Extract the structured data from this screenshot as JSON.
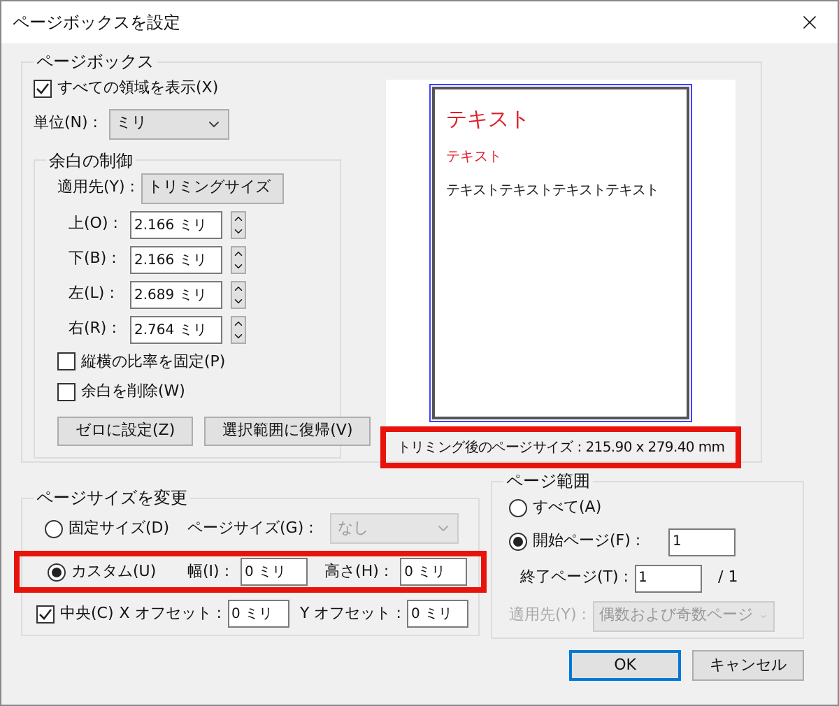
{
  "window": {
    "title": "ページボックスを設定"
  },
  "page_box": {
    "title": "ページボックス",
    "show_all": {
      "label": "すべての領域を表示(X)",
      "checked": true
    },
    "unit": {
      "label": "単位(N) :",
      "value": "ミリ"
    },
    "margins": {
      "title": "余白の制御",
      "apply_to": {
        "label": "適用先(Y) :",
        "value": "トリミングサイズ"
      },
      "fields": [
        {
          "label": "上(O) :",
          "value": "2.166 ミリ"
        },
        {
          "label": "下(B) :",
          "value": "2.166 ミリ"
        },
        {
          "label": "左(L) :",
          "value": "2.689 ミリ"
        },
        {
          "label": "右(R) :",
          "value": "2.764 ミリ"
        }
      ],
      "options": [
        {
          "label": "縦横の比率を固定(P)",
          "checked": false
        },
        {
          "label": "余白を削除(W)",
          "checked": false
        }
      ],
      "buttons": [
        "ゼロに設定(Z)",
        "選択範囲に復帰(V)"
      ]
    },
    "preview": {
      "lines": [
        {
          "text": "テキスト",
          "kind": "heading"
        },
        {
          "text": "テキスト",
          "kind": "subheading"
        },
        {
          "text": "テキストテキストテキストテキスト",
          "kind": "body"
        }
      ],
      "caption": "トリミング後のページサイズ : 215.90 x 279.40 mm",
      "highlighted": true
    }
  },
  "page_size": {
    "title": "ページサイズを変更",
    "fixed": {
      "label": "固定サイズ(D)",
      "selected": false,
      "size_label": "ページサイズ(G) :",
      "size_value": "なし",
      "disabled": true
    },
    "custom": {
      "label": "カスタム(U)",
      "selected": true,
      "highlighted": true,
      "width_label": "幅(I) :",
      "width": "0 ミリ",
      "height_label": "高さ(H) :",
      "height": "0 ミリ"
    },
    "center": {
      "label": "中央(C)",
      "checked": true,
      "x_label": "X オフセット :",
      "x": "0 ミリ",
      "y_label": "Y オフセット :",
      "y": "0 ミリ"
    }
  },
  "page_range": {
    "title": "ページ範囲",
    "all": {
      "label": "すべて(A)",
      "selected": false
    },
    "from": {
      "label": "開始ページ(F) :",
      "value": "1",
      "selected": true
    },
    "to": {
      "label": "終了ページ(T) :",
      "value": "1",
      "total": "/ 1"
    },
    "apply_to": {
      "label": "適用先(Y) :",
      "value": "偶数および奇数ページ",
      "disabled": true
    }
  },
  "buttons": [
    {
      "label": "OK",
      "default": true
    },
    {
      "label": "キャンセル",
      "default": false
    }
  ]
}
